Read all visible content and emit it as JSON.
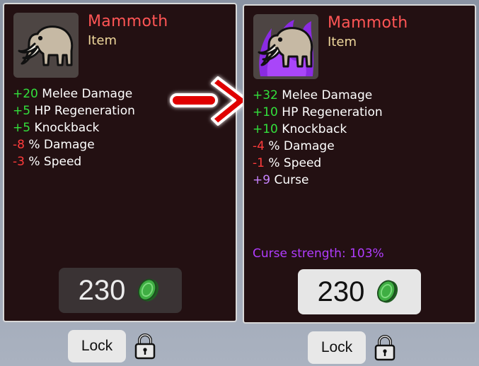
{
  "left_card": {
    "name": "Mammoth",
    "type": "Item",
    "stats": [
      {
        "value": "+20",
        "label": " Melee Damage",
        "kind": "pos"
      },
      {
        "value": "+5",
        "label": " HP Regeneration",
        "kind": "pos"
      },
      {
        "value": "+5",
        "label": " Knockback",
        "kind": "pos"
      },
      {
        "value": "-8",
        "label": " % Damage",
        "kind": "neg"
      },
      {
        "value": "-3",
        "label": " % Speed",
        "kind": "neg"
      }
    ],
    "price": "230",
    "lock_label": "Lock"
  },
  "right_card": {
    "name": "Mammoth",
    "type": "Item",
    "stats": [
      {
        "value": "+32",
        "label": " Melee Damage",
        "kind": "pos"
      },
      {
        "value": "+10",
        "label": " HP Regeneration",
        "kind": "pos"
      },
      {
        "value": "+10",
        "label": " Knockback",
        "kind": "pos"
      },
      {
        "value": "-4",
        "label": " % Damage",
        "kind": "neg"
      },
      {
        "value": "-1",
        "label": " % Speed",
        "kind": "neg"
      },
      {
        "value": "+9",
        "label": " Curse",
        "kind": "curse"
      }
    ],
    "curse_strength": "Curse strength: 103%",
    "price": "230",
    "lock_label": "Lock"
  },
  "colors": {
    "card_bg": "#231012",
    "name": "#ff5555",
    "type": "#efd89c",
    "positive": "#33e03c",
    "negative": "#ff3b3b",
    "curse": "#c884ff",
    "curse_strength": "#b13cff",
    "coin": "#3fae43",
    "arrow": "#e00000"
  },
  "icons": [
    "mammoth-icon",
    "cursed-mammoth-icon",
    "coin-icon",
    "padlock-icon",
    "arrow-right-icon"
  ]
}
